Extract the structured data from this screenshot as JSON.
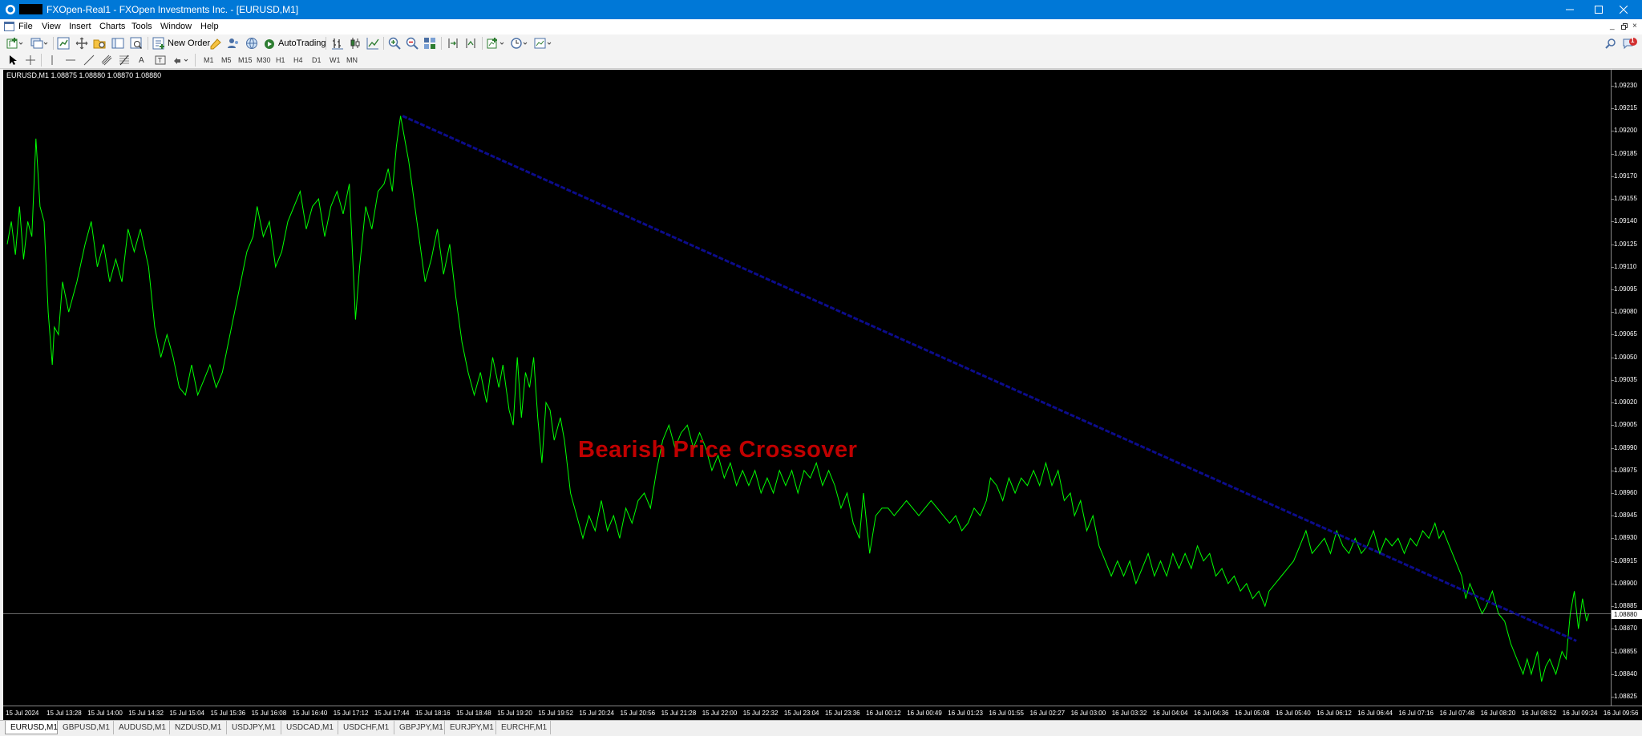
{
  "window": {
    "title": "FXOpen-Real1 - FXOpen Investments Inc. - [EURUSD,M1]",
    "accent": "#0078d7"
  },
  "menu": [
    "File",
    "View",
    "Insert",
    "Charts",
    "Tools",
    "Window",
    "Help"
  ],
  "toolbar": {
    "new_order": "New Order",
    "auto_trading": "AutoTrading",
    "timeframes": [
      "M1",
      "M5",
      "M15",
      "M30",
      "H1",
      "H4",
      "D1",
      "W1",
      "MN"
    ]
  },
  "notification_count": "1",
  "chart": {
    "header": "EURUSD,M1  1.08875 1.08880 1.08870 1.08880",
    "symbol": "EURUSD",
    "timeframe": "M1",
    "current_price": "1.08880",
    "annotation": "Bearish Price Crossover",
    "line_color": "#00ff00",
    "trendline_color": "#0c0c8c",
    "annotation_color": "#c00000",
    "price_ticks": [
      "1.09230",
      "1.09215",
      "1.09200",
      "1.09185",
      "1.09170",
      "1.09155",
      "1.09140",
      "1.09125",
      "1.09110",
      "1.09095",
      "1.09080",
      "1.09065",
      "1.09050",
      "1.09035",
      "1.09020",
      "1.09005",
      "1.08990",
      "1.08975",
      "1.08960",
      "1.08945",
      "1.08930",
      "1.08915",
      "1.08900",
      "1.08885",
      "1.08870",
      "1.08855",
      "1.08840",
      "1.08825"
    ],
    "time_ticks": [
      "15 Jul 2024",
      "15 Jul 13:28",
      "15 Jul 14:00",
      "15 Jul 14:32",
      "15 Jul 15:04",
      "15 Jul 15:36",
      "15 Jul 16:08",
      "15 Jul 16:40",
      "15 Jul 17:12",
      "15 Jul 17:44",
      "15 Jul 18:16",
      "15 Jul 18:48",
      "15 Jul 19:20",
      "15 Jul 19:52",
      "15 Jul 20:24",
      "15 Jul 20:56",
      "15 Jul 21:28",
      "15 Jul 22:00",
      "15 Jul 22:32",
      "15 Jul 23:04",
      "15 Jul 23:36",
      "16 Jul 00:12",
      "16 Jul 00:49",
      "16 Jul 01:23",
      "16 Jul 01:55",
      "16 Jul 02:27",
      "16 Jul 03:00",
      "16 Jul 03:32",
      "16 Jul 04:04",
      "16 Jul 04:36",
      "16 Jul 05:08",
      "16 Jul 05:40",
      "16 Jul 06:12",
      "16 Jul 06:44",
      "16 Jul 07:16",
      "16 Jul 07:48",
      "16 Jul 08:20",
      "16 Jul 08:52",
      "16 Jul 09:24",
      "16 Jul 09:56"
    ],
    "price_min": 1.08825,
    "price_max": 1.0923,
    "trendline": {
      "start": {
        "time_index": 9.65,
        "price": 1.0921
      },
      "end": {
        "time_index": 38.3,
        "price": 1.08862
      }
    },
    "current_price_value": 1.0888,
    "price_path": [
      [
        0,
        1.09125
      ],
      [
        0.1,
        1.0914
      ],
      [
        0.2,
        1.09118
      ],
      [
        0.3,
        1.0915
      ],
      [
        0.4,
        1.09115
      ],
      [
        0.5,
        1.0914
      ],
      [
        0.6,
        1.0913
      ],
      [
        0.7,
        1.09195
      ],
      [
        0.8,
        1.0915
      ],
      [
        0.9,
        1.0914
      ],
      [
        1.0,
        1.0908
      ],
      [
        1.1,
        1.09045
      ],
      [
        1.15,
        1.0907
      ],
      [
        1.25,
        1.09065
      ],
      [
        1.35,
        1.091
      ],
      [
        1.5,
        1.0908
      ],
      [
        1.7,
        1.091
      ],
      [
        1.9,
        1.09125
      ],
      [
        2.05,
        1.0914
      ],
      [
        2.2,
        1.0911
      ],
      [
        2.35,
        1.09125
      ],
      [
        2.5,
        1.091
      ],
      [
        2.65,
        1.09115
      ],
      [
        2.8,
        1.091
      ],
      [
        2.95,
        1.09135
      ],
      [
        3.1,
        1.0912
      ],
      [
        3.25,
        1.09135
      ],
      [
        3.45,
        1.0911
      ],
      [
        3.6,
        1.0907
      ],
      [
        3.75,
        1.0905
      ],
      [
        3.9,
        1.09065
      ],
      [
        4.05,
        1.0905
      ],
      [
        4.2,
        1.0903
      ],
      [
        4.35,
        1.09025
      ],
      [
        4.5,
        1.09045
      ],
      [
        4.65,
        1.09025
      ],
      [
        4.8,
        1.09035
      ],
      [
        4.95,
        1.09045
      ],
      [
        5.1,
        1.0903
      ],
      [
        5.25,
        1.0904
      ],
      [
        5.4,
        1.0906
      ],
      [
        5.55,
        1.0908
      ],
      [
        5.7,
        1.091
      ],
      [
        5.85,
        1.0912
      ],
      [
        6.0,
        1.0913
      ],
      [
        6.1,
        1.0915
      ],
      [
        6.25,
        1.0913
      ],
      [
        6.4,
        1.0914
      ],
      [
        6.55,
        1.0911
      ],
      [
        6.7,
        1.0912
      ],
      [
        6.85,
        1.0914
      ],
      [
        7.0,
        1.0915
      ],
      [
        7.15,
        1.0916
      ],
      [
        7.3,
        1.09135
      ],
      [
        7.45,
        1.0915
      ],
      [
        7.6,
        1.09155
      ],
      [
        7.75,
        1.0913
      ],
      [
        7.9,
        1.0915
      ],
      [
        8.05,
        1.0916
      ],
      [
        8.2,
        1.09145
      ],
      [
        8.35,
        1.09165
      ],
      [
        8.5,
        1.09075
      ],
      [
        8.6,
        1.0911
      ],
      [
        8.75,
        1.0915
      ],
      [
        8.9,
        1.09135
      ],
      [
        9.05,
        1.0916
      ],
      [
        9.2,
        1.09165
      ],
      [
        9.3,
        1.09175
      ],
      [
        9.4,
        1.0916
      ],
      [
        9.5,
        1.0919
      ],
      [
        9.6,
        1.0921
      ],
      [
        9.7,
        1.09195
      ],
      [
        9.8,
        1.0918
      ],
      [
        9.9,
        1.0916
      ],
      [
        10.0,
        1.0914
      ],
      [
        10.1,
        1.0912
      ],
      [
        10.2,
        1.091
      ],
      [
        10.35,
        1.09115
      ],
      [
        10.5,
        1.09135
      ],
      [
        10.65,
        1.09105
      ],
      [
        10.8,
        1.09125
      ],
      [
        10.95,
        1.0909
      ],
      [
        11.1,
        1.0906
      ],
      [
        11.25,
        1.0904
      ],
      [
        11.4,
        1.09025
      ],
      [
        11.55,
        1.0904
      ],
      [
        11.7,
        1.0902
      ],
      [
        11.85,
        1.0905
      ],
      [
        12.0,
        1.0903
      ],
      [
        12.1,
        1.09045
      ],
      [
        12.25,
        1.09015
      ],
      [
        12.35,
        1.09005
      ],
      [
        12.45,
        1.0905
      ],
      [
        12.55,
        1.0901
      ],
      [
        12.65,
        1.0904
      ],
      [
        12.75,
        1.0903
      ],
      [
        12.85,
        1.0905
      ],
      [
        12.95,
        1.0901
      ],
      [
        13.05,
        1.0898
      ],
      [
        13.15,
        1.0902
      ],
      [
        13.25,
        1.09015
      ],
      [
        13.35,
        1.08995
      ],
      [
        13.5,
        1.0901
      ],
      [
        13.6,
        1.08995
      ],
      [
        13.75,
        1.0896
      ],
      [
        13.9,
        1.08945
      ],
      [
        14.05,
        1.0893
      ],
      [
        14.2,
        1.08945
      ],
      [
        14.35,
        1.08935
      ],
      [
        14.5,
        1.08955
      ],
      [
        14.65,
        1.08935
      ],
      [
        14.8,
        1.08945
      ],
      [
        14.95,
        1.0893
      ],
      [
        15.1,
        1.0895
      ],
      [
        15.25,
        1.0894
      ],
      [
        15.4,
        1.08955
      ],
      [
        15.55,
        1.0896
      ],
      [
        15.7,
        1.0895
      ],
      [
        15.85,
        1.08975
      ],
      [
        16.0,
        1.08995
      ],
      [
        16.15,
        1.09005
      ],
      [
        16.3,
        1.0899
      ],
      [
        16.45,
        1.09
      ],
      [
        16.6,
        1.09005
      ],
      [
        16.75,
        1.0899
      ],
      [
        16.9,
        1.09
      ],
      [
        17.05,
        1.0899
      ],
      [
        17.2,
        1.08975
      ],
      [
        17.35,
        1.08985
      ],
      [
        17.5,
        1.0897
      ],
      [
        17.65,
        1.0898
      ],
      [
        17.8,
        1.08965
      ],
      [
        17.95,
        1.08975
      ],
      [
        18.1,
        1.08965
      ],
      [
        18.25,
        1.08975
      ],
      [
        18.4,
        1.0896
      ],
      [
        18.55,
        1.0897
      ],
      [
        18.7,
        1.0896
      ],
      [
        18.85,
        1.08975
      ],
      [
        19.0,
        1.08965
      ],
      [
        19.15,
        1.08975
      ],
      [
        19.3,
        1.0896
      ],
      [
        19.45,
        1.08975
      ],
      [
        19.6,
        1.0897
      ],
      [
        19.75,
        1.0898
      ],
      [
        19.9,
        1.08965
      ],
      [
        20.05,
        1.08975
      ],
      [
        20.2,
        1.08965
      ],
      [
        20.35,
        1.0895
      ],
      [
        20.5,
        1.0896
      ],
      [
        20.65,
        1.0894
      ],
      [
        20.8,
        1.0893
      ],
      [
        20.9,
        1.0896
      ],
      [
        21.05,
        1.0892
      ],
      [
        21.2,
        1.08945
      ],
      [
        21.35,
        1.0895
      ],
      [
        21.5,
        1.0895
      ],
      [
        21.65,
        1.08945
      ],
      [
        21.8,
        1.0895
      ],
      [
        21.95,
        1.08955
      ],
      [
        22.1,
        1.0895
      ],
      [
        22.25,
        1.08945
      ],
      [
        22.4,
        1.0895
      ],
      [
        22.55,
        1.08955
      ],
      [
        22.7,
        1.0895
      ],
      [
        22.85,
        1.08945
      ],
      [
        23.0,
        1.0894
      ],
      [
        23.15,
        1.08945
      ],
      [
        23.3,
        1.08935
      ],
      [
        23.45,
        1.0894
      ],
      [
        23.6,
        1.0895
      ],
      [
        23.75,
        1.08945
      ],
      [
        23.9,
        1.08955
      ],
      [
        24.0,
        1.0897
      ],
      [
        24.15,
        1.08965
      ],
      [
        24.3,
        1.08955
      ],
      [
        24.45,
        1.0897
      ],
      [
        24.6,
        1.0896
      ],
      [
        24.75,
        1.0897
      ],
      [
        24.9,
        1.08965
      ],
      [
        25.05,
        1.08975
      ],
      [
        25.2,
        1.08965
      ],
      [
        25.35,
        1.0898
      ],
      [
        25.5,
        1.08965
      ],
      [
        25.65,
        1.08975
      ],
      [
        25.8,
        1.08955
      ],
      [
        25.95,
        1.0896
      ],
      [
        26.05,
        1.08945
      ],
      [
        26.2,
        1.08955
      ],
      [
        26.35,
        1.08935
      ],
      [
        26.5,
        1.08945
      ],
      [
        26.65,
        1.08925
      ],
      [
        26.8,
        1.08915
      ],
      [
        26.95,
        1.08905
      ],
      [
        27.1,
        1.08915
      ],
      [
        27.25,
        1.08905
      ],
      [
        27.4,
        1.08915
      ],
      [
        27.55,
        1.089
      ],
      [
        27.7,
        1.0891
      ],
      [
        27.85,
        1.0892
      ],
      [
        28.0,
        1.08905
      ],
      [
        28.15,
        1.08915
      ],
      [
        28.3,
        1.08905
      ],
      [
        28.45,
        1.0892
      ],
      [
        28.6,
        1.0891
      ],
      [
        28.75,
        1.0892
      ],
      [
        28.9,
        1.0891
      ],
      [
        29.05,
        1.08925
      ],
      [
        29.2,
        1.08915
      ],
      [
        29.35,
        1.0892
      ],
      [
        29.5,
        1.08905
      ],
      [
        29.65,
        1.0891
      ],
      [
        29.8,
        1.089
      ],
      [
        29.95,
        1.08905
      ],
      [
        30.1,
        1.08895
      ],
      [
        30.25,
        1.089
      ],
      [
        30.4,
        1.0889
      ],
      [
        30.55,
        1.08895
      ],
      [
        30.7,
        1.08885
      ],
      [
        30.8,
        1.08895
      ],
      [
        30.95,
        1.089
      ],
      [
        31.1,
        1.08905
      ],
      [
        31.25,
        1.0891
      ],
      [
        31.4,
        1.08915
      ],
      [
        31.55,
        1.08925
      ],
      [
        31.7,
        1.08935
      ],
      [
        31.85,
        1.0892
      ],
      [
        32.0,
        1.08925
      ],
      [
        32.15,
        1.0893
      ],
      [
        32.3,
        1.0892
      ],
      [
        32.45,
        1.08935
      ],
      [
        32.6,
        1.08925
      ],
      [
        32.75,
        1.0892
      ],
      [
        32.9,
        1.0893
      ],
      [
        33.05,
        1.0892
      ],
      [
        33.2,
        1.08925
      ],
      [
        33.35,
        1.08935
      ],
      [
        33.5,
        1.0892
      ],
      [
        33.65,
        1.0893
      ],
      [
        33.8,
        1.08925
      ],
      [
        33.95,
        1.0893
      ],
      [
        34.1,
        1.0892
      ],
      [
        34.25,
        1.0893
      ],
      [
        34.4,
        1.08925
      ],
      [
        34.55,
        1.08935
      ],
      [
        34.7,
        1.0893
      ],
      [
        34.85,
        1.0894
      ],
      [
        34.95,
        1.0893
      ],
      [
        35.05,
        1.08935
      ],
      [
        35.2,
        1.08925
      ],
      [
        35.35,
        1.08915
      ],
      [
        35.5,
        1.08905
      ],
      [
        35.6,
        1.0889
      ],
      [
        35.7,
        1.089
      ],
      [
        35.85,
        1.0889
      ],
      [
        36.0,
        1.0888
      ],
      [
        36.1,
        1.08885
      ],
      [
        36.25,
        1.08895
      ],
      [
        36.4,
        1.0888
      ],
      [
        36.55,
        1.08875
      ],
      [
        36.7,
        1.0886
      ],
      [
        36.85,
        1.0885
      ],
      [
        37.0,
        1.0884
      ],
      [
        37.1,
        1.0885
      ],
      [
        37.2,
        1.0884
      ],
      [
        37.35,
        1.08855
      ],
      [
        37.45,
        1.08835
      ],
      [
        37.55,
        1.08845
      ],
      [
        37.65,
        1.0885
      ],
      [
        37.8,
        1.0884
      ],
      [
        37.95,
        1.08855
      ],
      [
        38.05,
        1.0885
      ],
      [
        38.15,
        1.0888
      ],
      [
        38.25,
        1.08895
      ],
      [
        38.35,
        1.0887
      ],
      [
        38.45,
        1.0889
      ],
      [
        38.55,
        1.08875
      ],
      [
        38.6,
        1.0888
      ]
    ]
  },
  "tabs": [
    "EURUSD,M1",
    "GBPUSD,M1",
    "AUDUSD,M1",
    "NZDUSD,M1",
    "USDJPY,M1",
    "USDCAD,M1",
    "USDCHF,M1",
    "GBPJPY,M1",
    "EURJPY,M1",
    "EURCHF,M1"
  ]
}
